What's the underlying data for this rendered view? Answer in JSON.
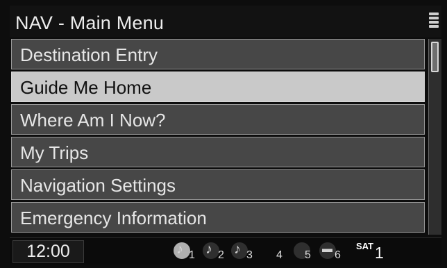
{
  "header": {
    "title": "NAV - Main Menu",
    "icon": "signal-bars-icon"
  },
  "menu": {
    "items": [
      {
        "label": "Destination Entry",
        "selected": false
      },
      {
        "label": "Guide Me Home",
        "selected": true
      },
      {
        "label": "Where Am I Now?",
        "selected": false
      },
      {
        "label": "My Trips",
        "selected": false
      },
      {
        "label": "Navigation Settings",
        "selected": false
      },
      {
        "label": "Emergency Information",
        "selected": false
      }
    ]
  },
  "status_bar": {
    "time": "12:00",
    "presets": [
      {
        "number": "1",
        "icon": "music-note-icon",
        "active": true
      },
      {
        "number": "2",
        "icon": "music-note-icon",
        "active": false
      },
      {
        "number": "3",
        "icon": "music-note-icon",
        "active": false
      },
      {
        "number": "4",
        "icon": "",
        "active": false
      },
      {
        "number": "5",
        "icon": "",
        "active": false
      },
      {
        "number": "6",
        "icon": "clapperboard-icon",
        "active": false
      }
    ],
    "band": "SAT",
    "band_preset": "1"
  },
  "colors": {
    "background": "#0d0d0d",
    "menu_item": "#474747",
    "menu_item_selected": "#c9c9c9",
    "text": "#e6e6e6"
  }
}
